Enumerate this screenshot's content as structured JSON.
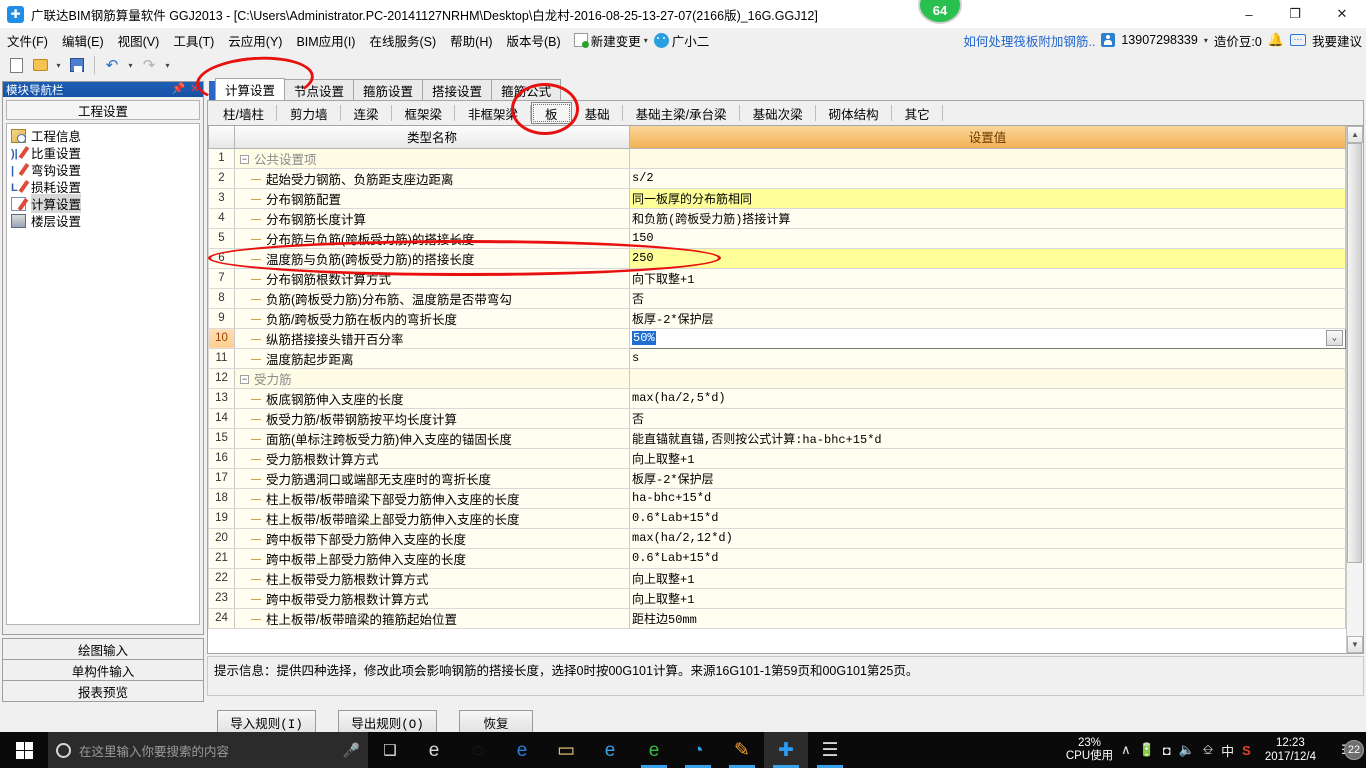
{
  "window": {
    "title": "广联达BIM钢筋算量软件 GGJ2013 - [C:\\Users\\Administrator.PC-20141127NRHM\\Desktop\\白龙村-2016-08-25-13-27-07(2166版)_16G.GGJ12]",
    "minimize": "–",
    "restore": "❐",
    "close": "✕",
    "badge": "64"
  },
  "menu": {
    "items": [
      "文件(F)",
      "编辑(E)",
      "视图(V)",
      "工具(T)",
      "云应用(Y)",
      "BIM应用(I)",
      "在线服务(S)",
      "帮助(H)",
      "版本号(B)"
    ],
    "new_change": "新建变更",
    "new_change_arrow": "▾",
    "assistant": "广小二",
    "help_link": "如何处理筏板附加钢筋..",
    "account": "13907298339",
    "account_arrow": "▾",
    "points": "造价豆:0",
    "bell": "🔔",
    "suggest": "我要建议",
    "chat_dots": "···"
  },
  "toolbar": {
    "new": "new-file",
    "open": "open-folder",
    "save": "save-disk",
    "undo": "↶",
    "redo": "↷",
    "dropdown": "▾"
  },
  "dock": {
    "title": "模块导航栏",
    "pin": "📌",
    "close": "✕",
    "section": "工程设置",
    "items": [
      {
        "label": "工程信息",
        "icon": "project-info-icon"
      },
      {
        "label": "比重设置",
        "icon": "weight-settings-icon"
      },
      {
        "label": "弯钩设置",
        "icon": "hook-settings-icon"
      },
      {
        "label": "损耗设置",
        "icon": "loss-settings-icon"
      },
      {
        "label": "计算设置",
        "icon": "calc-settings-icon"
      },
      {
        "label": "楼层设置",
        "icon": "floor-settings-icon"
      }
    ],
    "selected_index": 4,
    "bottom_buttons": [
      "绘图输入",
      "单构件输入",
      "报表预览"
    ]
  },
  "tabs_primary": {
    "items": [
      "计算设置",
      "节点设置",
      "箍筋设置",
      "搭接设置",
      "箍筋公式"
    ],
    "active_index": 0
  },
  "tabs_secondary": {
    "items": [
      "柱/墙柱",
      "剪力墙",
      "连梁",
      "框架梁",
      "非框架梁",
      "板",
      "基础",
      "基础主梁/承台梁",
      "基础次梁",
      "砌体结构",
      "其它"
    ],
    "selected_index": 5
  },
  "grid": {
    "headers": {
      "num": "",
      "name": "类型名称",
      "value": "设置值"
    },
    "rows": [
      {
        "n": "1",
        "type": "group",
        "name": "公共设置项",
        "value": "",
        "expander": "−"
      },
      {
        "n": "2",
        "type": "item",
        "name": "起始受力钢筋、负筋距支座边距离",
        "value": "s/2"
      },
      {
        "n": "3",
        "type": "item",
        "name": "分布钢筋配置",
        "value": "同一板厚的分布筋相同",
        "highlight": "yellow"
      },
      {
        "n": "4",
        "type": "item",
        "name": "分布钢筋长度计算",
        "value": "和负筋(跨板受力筋)搭接计算"
      },
      {
        "n": "5",
        "type": "item",
        "name": "分布筋与负筋(跨板受力筋)的搭接长度",
        "value": "150"
      },
      {
        "n": "6",
        "type": "item",
        "name": "温度筋与负筋(跨板受力筋)的搭接长度",
        "value": "250",
        "highlight": "yellow"
      },
      {
        "n": "7",
        "type": "item",
        "name": "分布钢筋根数计算方式",
        "value": "向下取整+1"
      },
      {
        "n": "8",
        "type": "item",
        "name": "负筋(跨板受力筋)分布筋、温度筋是否带弯勾",
        "value": "否"
      },
      {
        "n": "9",
        "type": "item",
        "name": "负筋/跨板受力筋在板内的弯折长度",
        "value": "板厚-2*保护层"
      },
      {
        "n": "10",
        "type": "item",
        "name": "纵筋搭接接头错开百分率",
        "value": "50%",
        "editing": true,
        "selected_text": true
      },
      {
        "n": "11",
        "type": "item",
        "name": "温度筋起步距离",
        "value": "s"
      },
      {
        "n": "12",
        "type": "group",
        "name": "受力筋",
        "value": "",
        "expander": "−"
      },
      {
        "n": "13",
        "type": "item",
        "name": "板底钢筋伸入支座的长度",
        "value": "max(ha/2,5*d)"
      },
      {
        "n": "14",
        "type": "item",
        "name": "板受力筋/板带钢筋按平均长度计算",
        "value": "否"
      },
      {
        "n": "15",
        "type": "item",
        "name": "面筋(单标注跨板受力筋)伸入支座的锚固长度",
        "value": "能直锚就直锚,否则按公式计算:ha-bhc+15*d"
      },
      {
        "n": "16",
        "type": "item",
        "name": "受力筋根数计算方式",
        "value": "向上取整+1"
      },
      {
        "n": "17",
        "type": "item",
        "name": "受力筋遇洞口或端部无支座时的弯折长度",
        "value": "板厚-2*保护层"
      },
      {
        "n": "18",
        "type": "item",
        "name": "柱上板带/板带暗梁下部受力筋伸入支座的长度",
        "value": "ha-bhc+15*d"
      },
      {
        "n": "19",
        "type": "item",
        "name": "柱上板带/板带暗梁上部受力筋伸入支座的长度",
        "value": "0.6*Lab+15*d"
      },
      {
        "n": "20",
        "type": "item",
        "name": "跨中板带下部受力筋伸入支座的长度",
        "value": "max(ha/2,12*d)"
      },
      {
        "n": "21",
        "type": "item",
        "name": "跨中板带上部受力筋伸入支座的长度",
        "value": "0.6*Lab+15*d"
      },
      {
        "n": "22",
        "type": "item",
        "name": "柱上板带受力筋根数计算方式",
        "value": "向上取整+1"
      },
      {
        "n": "23",
        "type": "item",
        "name": "跨中板带受力筋根数计算方式",
        "value": "向上取整+1"
      },
      {
        "n": "24",
        "type": "item",
        "name": "柱上板带/板带暗梁的箍筋起始位置",
        "value": "距柱边50mm"
      }
    ],
    "scroll_up": "▲",
    "scroll_down": "▼",
    "dropdown_arrow": "⌄"
  },
  "hint": {
    "label": "提示信息：",
    "text": "提供四种选择，修改此项会影响钢筋的搭接长度，选择0时按00G101计算。来源16G101-1第59页和00G101第25页。"
  },
  "action_buttons": [
    "导入规则(I)",
    "导出规则(O)",
    "恢复"
  ],
  "taskbar": {
    "search_placeholder": "在这里输入你要搜索的内容",
    "mic": "🎤",
    "taskview": "❑",
    "cpu_percent": "23%",
    "cpu_label": "CPU使用",
    "time": "12:23",
    "date": "2017/12/4",
    "notif_count": "22",
    "ime": "中",
    "tray_up": "∧",
    "icons": [
      {
        "name": "ie-browser-icon",
        "glyph": "e",
        "color": "#d9d9d9",
        "running": false
      },
      {
        "name": "app-swirl-icon",
        "glyph": "◌",
        "color": "#2b2b2b",
        "running": false
      },
      {
        "name": "edge-browser-icon",
        "glyph": "e",
        "color": "#2a7fd4",
        "running": false
      },
      {
        "name": "file-explorer-icon",
        "glyph": "▭",
        "color": "#f2cf7a",
        "running": false
      },
      {
        "name": "internet-explorer-icon",
        "glyph": "e",
        "color": "#3aa0e0",
        "running": false
      },
      {
        "name": "green-browser-icon",
        "glyph": "e",
        "color": "#3aba45",
        "running": true
      },
      {
        "name": "360-browser-icon",
        "glyph": "◔",
        "color": "#2aa3e8",
        "running": true
      },
      {
        "name": "notes-app-icon",
        "glyph": "✎",
        "color": "#f0a030",
        "running": true
      },
      {
        "name": "glodon-app-icon",
        "glyph": "✚",
        "color": "#2a9bf0",
        "running": true,
        "active": true
      },
      {
        "name": "report-app-icon",
        "glyph": "☰",
        "color": "#d8d8d8",
        "running": true
      }
    ]
  },
  "annotations": {
    "circle_tab_calc": "计算设置",
    "circle_tab_slab": "板",
    "circle_row6": "温度筋与负筋(跨板受力筋)的搭接长度"
  }
}
